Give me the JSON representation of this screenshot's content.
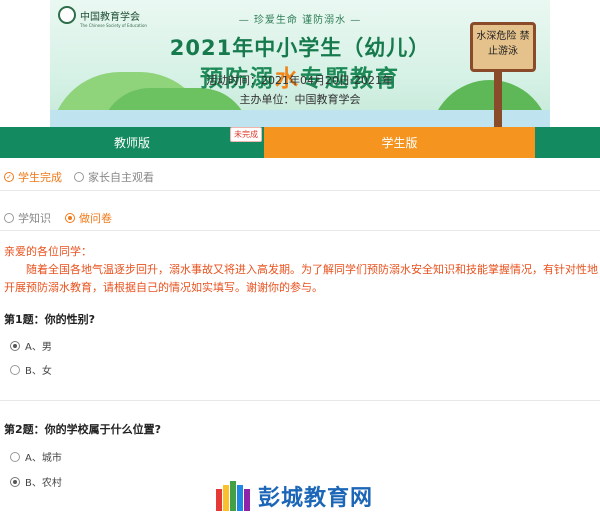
{
  "banner": {
    "logo_text": "中国教育学会",
    "logo_sub": "The Chinese Society of Education",
    "slogan": "— 珍爱生命  谨防溺水 —",
    "title_line1": "2021年中小学生（幼儿）",
    "title_line2_a": "预防溺",
    "title_line2_b": "水",
    "title_line2_c": "专题教育",
    "date": "活动时间：2021年04月20日-2021年",
    "host": "主办单位：中国教育学会",
    "sign_text": "水深危险 禁止游泳"
  },
  "tabs": {
    "teacher": "教师版",
    "teacher_badge": "未完成",
    "student": "学生版"
  },
  "mode": {
    "student_done": "学生完成",
    "parent_watch": "家长自主观看"
  },
  "subtabs": {
    "learn": "学知识",
    "quiz": "做问卷"
  },
  "intro": {
    "greeting": "亲爱的各位同学：",
    "body": "随着全国各地气温逐步回升，溺水事故又将进入高发期。为了解同学们预防溺水安全知识和技能掌握情况，有针对性地开展预防溺水教育，请根据自己的情况如实填写。谢谢你的参与。"
  },
  "questions": [
    {
      "title": "第1题：你的性别?",
      "options": [
        "A、男",
        "B、女"
      ],
      "selected": 0
    },
    {
      "title": "第2题：你的学校属于什么位置?",
      "options": [
        "A、城市",
        "B、农村"
      ],
      "selected": 1
    }
  ],
  "watermark": "彭城教育网",
  "colors": {
    "green": "#138a5f",
    "orange": "#f5941e",
    "intro_red": "#e8521f"
  }
}
